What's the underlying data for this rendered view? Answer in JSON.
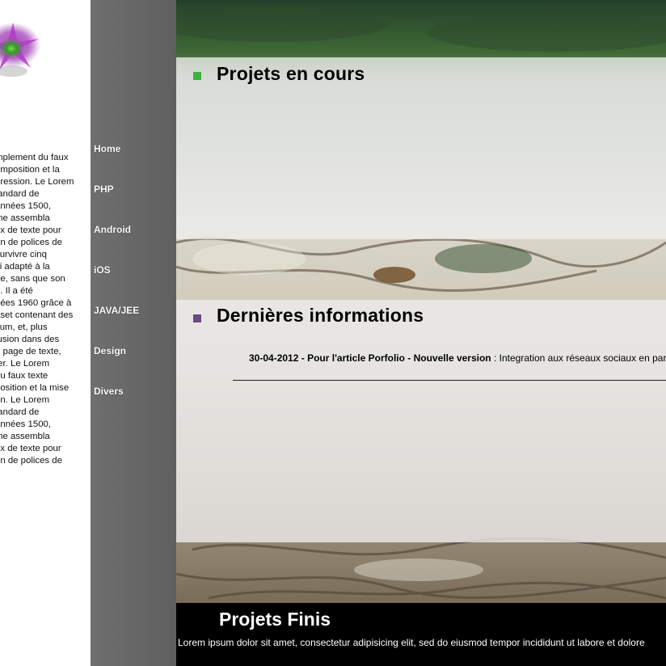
{
  "intro": {
    "lines": [
      "mplement du faux",
      "omposition et la",
      "pression. Le Lorem",
      "tandard de",
      "années 1500,",
      "me assembla",
      "ux de texte pour",
      "en de polices de",
      "survivre cinq",
      "si adapté à la",
      "ne, sans que son",
      "é. Il a été",
      "nées 1960 grâce à",
      "aset contenant des",
      "sum, et, plus",
      "lusion dans des",
      "n page de texte,",
      "ter. Le Lorem",
      "du faux texte",
      "position et la mise",
      "on. Le Lorem",
      "tandard de",
      "années 1500,",
      "me assembla",
      "ux de texte pour",
      "en de polices de"
    ]
  },
  "nav": {
    "items": [
      {
        "label": "Home"
      },
      {
        "label": "PHP"
      },
      {
        "label": "Android"
      },
      {
        "label": "iOS"
      },
      {
        "label": "JAVA/JEE"
      },
      {
        "label": "Design"
      },
      {
        "label": "Divers"
      }
    ]
  },
  "sections": {
    "projets_en_cours": {
      "title": "Projets en cours",
      "accent": "#3db33d"
    },
    "dernieres_informations": {
      "title": "Dernières informations",
      "accent": "#6b4b86",
      "news": {
        "date": "30-04-2012",
        "separator": " - ",
        "label": "Pour l'article Porfolio - Nouvelle version",
        "text": " : Integration aux réseaux sociaux en par"
      }
    },
    "projets_finis": {
      "title": "Projets Finis",
      "text": "Lorem ipsum dolor sit amet, consectetur adipisicing elit, sed do eiusmod tempor incididunt ut labore et dolore"
    }
  },
  "colors": {
    "nav_bg": "#666666",
    "footer_bg": "#000000"
  }
}
